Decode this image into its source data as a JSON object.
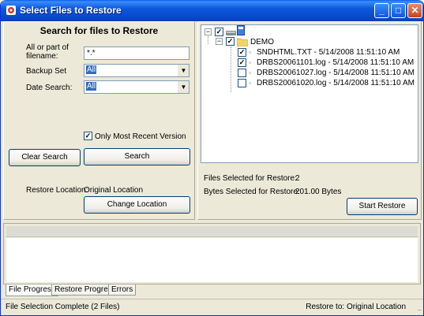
{
  "window": {
    "title": "Select Files to Restore",
    "accent": "#0a5fe8"
  },
  "search": {
    "heading": "Search for files to Restore",
    "filename_label": "All or part of filename:",
    "filename_value": "*.*",
    "backup_set_label": "Backup Set",
    "backup_set_value": "All",
    "date_search_label": "Date Search:",
    "date_search_value": "All",
    "most_recent_label": "Only Most Recent Version",
    "most_recent_checked": true,
    "clear_button": "Clear Search",
    "search_button": "Search"
  },
  "restore_location": {
    "label": "Restore Location:",
    "value": "Original Location",
    "change_button": "Change Location"
  },
  "tree": {
    "folder": "DEMO",
    "files": [
      {
        "name": "SNDHTML.TXT - 5/14/2008 11:51:10 AM",
        "checked": true
      },
      {
        "name": "DRBS20061101.log - 5/14/2008 11:51:10 AM",
        "checked": true
      },
      {
        "name": "DRBS20061027.log - 5/14/2008 11:51:10 AM",
        "checked": false
      },
      {
        "name": "DRBS20061020.log - 5/14/2008 11:51:10 AM",
        "checked": false
      }
    ]
  },
  "summary": {
    "files_label": "Files Selected for Restore:",
    "files_value": "2",
    "bytes_label": "Bytes Selected for Restore:",
    "bytes_value": "201.00 Bytes",
    "start_button": "Start Restore"
  },
  "tabs": [
    "File Progress",
    "Restore Progress",
    "Errors"
  ],
  "status": {
    "left": "File Selection Complete (2 Files)",
    "right": "Restore to: Original Location",
    "grip": "..."
  }
}
